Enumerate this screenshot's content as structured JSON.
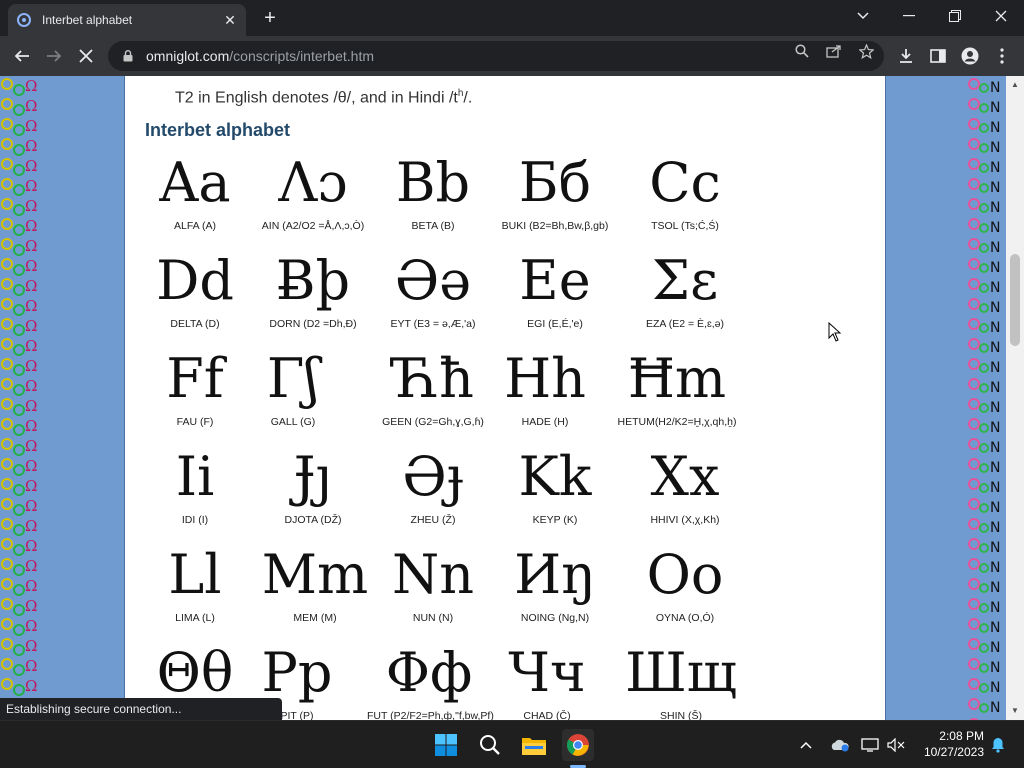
{
  "browser": {
    "tab_title": "Interbet alphabet",
    "new_tab_symbol": "+",
    "url_host": "omniglot.com",
    "url_path": "/conscripts/interbet.htm",
    "status_text": "Establishing secure connection..."
  },
  "page": {
    "intro_text": "T2 in English denotes /θ/, and in Hindi /t",
    "intro_sup": "h",
    "intro_end": "/.",
    "section_title": "Interbet alphabet",
    "letters": [
      {
        "glyph": "Aa",
        "caption": "ALFA (A)"
      },
      {
        "glyph": "Λɔ",
        "caption": "AIN (A2/O2 =Å,Λ,ɔ,Ò)"
      },
      {
        "glyph": "Bb",
        "caption": "BETA (B)"
      },
      {
        "glyph": "Бб",
        "caption": "BUKI (B2=Bh,Bw,β,gb)"
      },
      {
        "glyph": "Cc",
        "caption": "TSOL (Ts;Ć,Ś)"
      },
      {
        "glyph": "Dd",
        "caption": "DELTA (D)"
      },
      {
        "glyph": "Ƀþ",
        "caption": "DORN (D2 =Dh,Ð)"
      },
      {
        "glyph": "Əə",
        "caption": "EYT (E3 = ə,Æ,'a)"
      },
      {
        "glyph": "Ee",
        "caption": "EGI (E,É,'e)"
      },
      {
        "glyph": "Ʃε",
        "caption": "EZA (E2 = È,ɛ,ə)"
      },
      {
        "glyph": "Ff",
        "caption": "FAU (F)"
      },
      {
        "glyph": "Γʃ",
        "caption": "GALL (G)"
      },
      {
        "glyph": "Ћħ",
        "caption": "GEEN (G2=Gh,ɣ,G,ɦ)"
      },
      {
        "glyph": "Hh",
        "caption": "HADE (H)"
      },
      {
        "glyph": "Ħm",
        "caption": "HETUM(H2/K2=Ḫ,χ,qh,ẖ)"
      },
      {
        "glyph": "Ii",
        "caption": "IDI (I)"
      },
      {
        "glyph": "Ɉȷ",
        "caption": "DJOTA (DŽ)"
      },
      {
        "glyph": "Əɟ",
        "caption": "ZHEU (Ž)"
      },
      {
        "glyph": "Kk",
        "caption": "KEYP (K)"
      },
      {
        "glyph": "Xx",
        "caption": "HHIVI (X,χ,Kh)"
      },
      {
        "glyph": "Ll",
        "caption": "LIMA (L)"
      },
      {
        "glyph": "Mm",
        "caption": "MEM (M)"
      },
      {
        "glyph": "Nn",
        "caption": "NUN (N)"
      },
      {
        "glyph": "Иŋ",
        "caption": "NOING (Ng,N)"
      },
      {
        "glyph": "Oo",
        "caption": "OYNA (O,Ó)"
      },
      {
        "glyph": "Θθ",
        "caption": ""
      },
      {
        "glyph": "Pp",
        "caption": "PIT (P)"
      },
      {
        "glyph": "Φф",
        "caption": "FUT (P2/F2=Ph,ф,\"f,bw,Pf)"
      },
      {
        "glyph": "Чч",
        "caption": "CHAD (Č)"
      },
      {
        "glyph": "Шщ",
        "caption": "SHIN (Š)"
      }
    ]
  },
  "taskbar": {
    "time": "2:08 PM",
    "date": "10/27/2023"
  },
  "colors": {
    "page_bg": "#6f9bd1",
    "heading": "#244a6b",
    "chrome_dark": "#202124",
    "chrome_toolbar": "#35363a"
  },
  "icons": [
    "chrome-favicon",
    "close-icon",
    "plus-icon",
    "chevron-down-icon",
    "minimize-icon",
    "restore-icon",
    "window-close-icon",
    "back-icon",
    "forward-icon",
    "stop-icon",
    "lock-icon",
    "search-icon",
    "share-icon",
    "star-icon",
    "download-icon",
    "sidepanel-icon",
    "profile-icon",
    "menu-icon",
    "windows-start-icon",
    "taskbar-search-icon",
    "file-explorer-icon",
    "chrome-icon",
    "tray-chevron-icon",
    "onedrive-icon",
    "display-icon",
    "volume-muted-icon",
    "notification-bell-icon"
  ]
}
